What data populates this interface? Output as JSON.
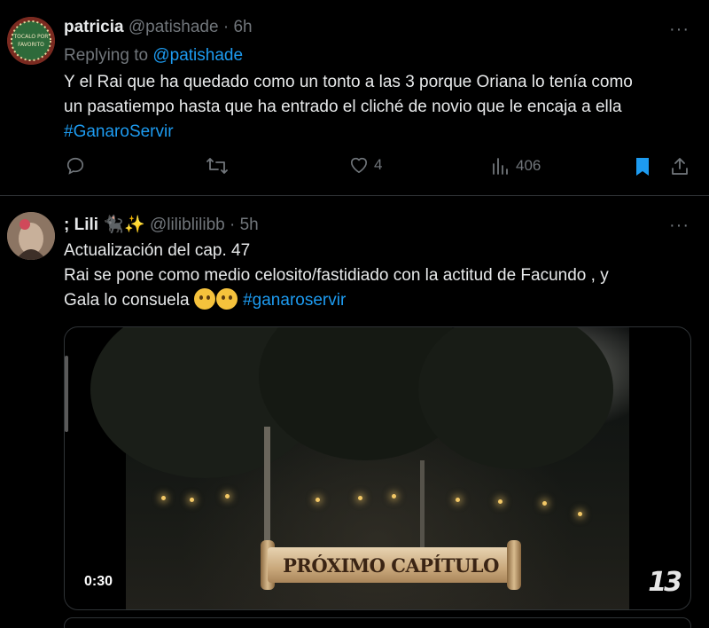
{
  "tweets": [
    {
      "name": "patricia",
      "handle": "@patishade",
      "separator": "·",
      "time": "6h",
      "reply_prefix": "Replying to",
      "reply_mention": "@patishade",
      "text_line1": "Y el Rai que ha quedado como un tonto a las 3 porque Oriana lo tenía como",
      "text_line2": "un pasatiempo hasta que ha entrado el cliché de novio que le encaja a ella",
      "hashtag": "#GanaroServir",
      "more": "···",
      "likes": "4",
      "views": "406",
      "bookmarked": true,
      "avatar_text": "TOCALO POR FAVORITO"
    },
    {
      "name": "; Lili",
      "name_emojis": "🐈‍⬛✨",
      "handle": "@liliblilibb",
      "separator": "·",
      "time": "5h",
      "text_line1": "Actualización del cap. 47",
      "text_line2": "Rai se pone como medio celosito/fastidiado con la actitud de Facundo , y",
      "text_line3_prefix": "Gala lo consuela",
      "hashtag": "#ganaroservir",
      "more": "···",
      "video": {
        "duration": "0:30",
        "banner_text": "PRÓXIMO CAPÍTULO",
        "channel_logo": "13"
      }
    }
  ],
  "colors": {
    "background": "#000000",
    "text": "#e7e9ea",
    "muted": "#71767b",
    "accent": "#1d9bf0",
    "divider": "#2f3336"
  },
  "icons": [
    "reply-icon",
    "retweet-icon",
    "like-icon",
    "views-icon",
    "bookmark-icon",
    "share-icon",
    "more-icon"
  ]
}
